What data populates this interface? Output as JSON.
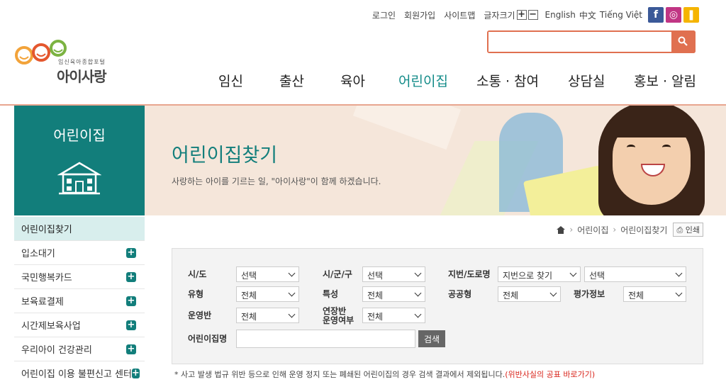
{
  "util": {
    "login": "로그인",
    "join": "회원가입",
    "sitemap": "사이트맵",
    "font_size": "글자크기",
    "font_plus": "+",
    "font_minus": "−",
    "languages": [
      "English",
      "中文",
      "Tiếng Việt"
    ]
  },
  "search": {
    "placeholder": ""
  },
  "logo": {
    "tagline": "임신육아종합포털",
    "name": "아이사랑"
  },
  "gnb": [
    "임신",
    "출산",
    "육아",
    "어린이집",
    "소통 · 참여",
    "상담실",
    "홍보 · 알림"
  ],
  "side": {
    "title": "어린이집"
  },
  "banner": {
    "title": "어린이집찾기",
    "subtitle": "사랑하는 아이를 기르는 일, \"아이사랑\"이 함께 하겠습니다."
  },
  "lnb": [
    "어린이집찾기",
    "입소대기",
    "국민행복카드",
    "보육료결제",
    "시간제보육사업",
    "우리아이 건강관리",
    "어린이집 이용 불편신고 센터"
  ],
  "location": {
    "depth1": "어린이집",
    "depth2": "어린이집찾기",
    "print": "인쇄"
  },
  "form": {
    "sido_label": "시/도",
    "sido_value": "선택",
    "sigungu_label": "시/군/구",
    "sigungu_value": "선택",
    "addr_label": "지번/도로명",
    "addr_type_value": "지번으로 찾기",
    "addr_value": "선택",
    "type_label": "유형",
    "type_value": "전체",
    "feature_label": "특성",
    "feature_value": "전체",
    "public_label": "공공형",
    "public_value": "전체",
    "eval_label": "평가정보",
    "eval_value": "전체",
    "class_label": "운영반",
    "class_value": "전체",
    "extended_label_1": "연장반",
    "extended_label_2": "운영여부",
    "extended_value": "전체",
    "name_label": "어린이집명",
    "search_button": "검색"
  },
  "notice": {
    "text": "* 사고 발생 법규 위반 등으로 인해 운영 정지 또는 폐쇄된 어린이집의 경우 검색 결과에서 제외됩니다.",
    "link": "(위반사실의 공표 바로가기)"
  },
  "colors": {
    "brand": "#127e7b",
    "accent": "#e07050"
  }
}
